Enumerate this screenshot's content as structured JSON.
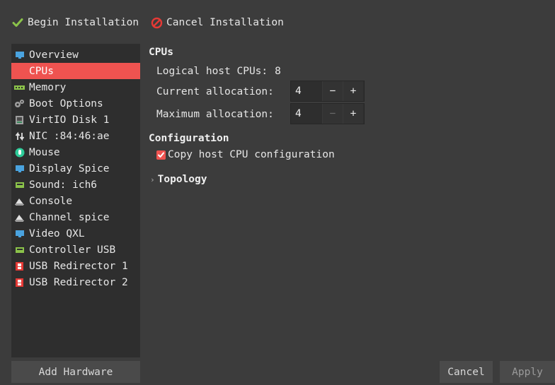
{
  "toolbar": {
    "begin_label": "Begin Installation",
    "begin_icon": "checkmark-icon",
    "cancel_label": "Cancel Installation",
    "cancel_icon": "cancel-circle-icon"
  },
  "sidebar": {
    "selected_index": 1,
    "items": [
      {
        "label": "Overview",
        "icon": "monitor-icon"
      },
      {
        "label": "CPUs",
        "icon": "cpu-icon"
      },
      {
        "label": "Memory",
        "icon": "memory-icon"
      },
      {
        "label": "Boot Options",
        "icon": "gears-icon"
      },
      {
        "label": "VirtIO Disk 1",
        "icon": "disk-icon"
      },
      {
        "label": "NIC :84:46:ae",
        "icon": "network-icon"
      },
      {
        "label": "Mouse",
        "icon": "mouse-icon"
      },
      {
        "label": "Display Spice",
        "icon": "display-icon"
      },
      {
        "label": "Sound: ich6",
        "icon": "sound-card-icon"
      },
      {
        "label": "Console",
        "icon": "serial-icon"
      },
      {
        "label": "Channel spice",
        "icon": "channel-icon"
      },
      {
        "label": "Video QXL",
        "icon": "video-icon"
      },
      {
        "label": "Controller USB",
        "icon": "controller-icon"
      },
      {
        "label": "USB Redirector 1",
        "icon": "usb-redirector-icon"
      },
      {
        "label": "USB Redirector 2",
        "icon": "usb-redirector-icon"
      }
    ],
    "add_hardware_label": "Add Hardware"
  },
  "cpus": {
    "title": "CPUs",
    "logical_label": "Logical host CPUs:",
    "logical_value": "8",
    "current_label": "Current allocation:",
    "current_value": "4",
    "max_label": "Maximum allocation:",
    "max_value": "4",
    "minus": "−",
    "plus": "+"
  },
  "configuration": {
    "title": "Configuration",
    "copy_host_label": "Copy host CPU configuration",
    "copy_host_checked": true
  },
  "topology": {
    "label": "Topology",
    "expander_glyph": "›"
  },
  "footer": {
    "cancel_label": "Cancel",
    "apply_label": "Apply"
  },
  "colors": {
    "accent": "#ef5350",
    "background": "#3c3c3c",
    "sidebar_bg": "#2e2e2e"
  }
}
